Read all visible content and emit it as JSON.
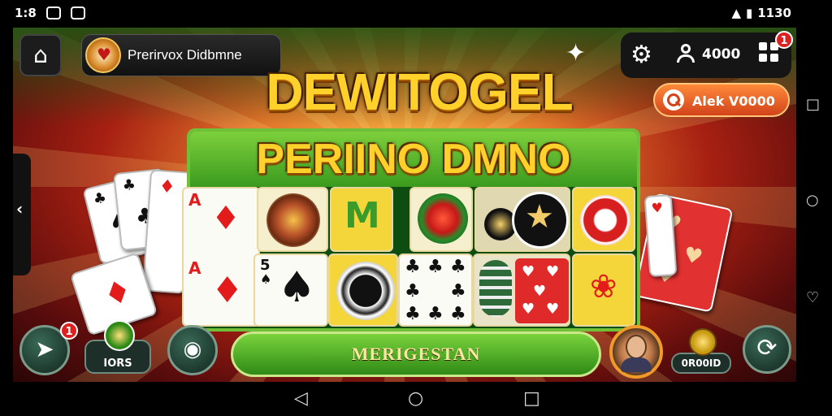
{
  "status_bar": {
    "time_left": "1:8",
    "time_right": "1130",
    "signal": "◂"
  },
  "profile": {
    "name": "Prerirvox Didbmne"
  },
  "top_bar": {
    "coins": "4000",
    "notification_count": "1"
  },
  "search": {
    "label": "Alek V0000"
  },
  "titles": {
    "main": "DEWITOGEL",
    "sub": "PERIINO DMNO"
  },
  "bottom": {
    "left_badge": "1",
    "pill_left_label": "IORS",
    "main_button": "MERIGESTAN",
    "pill_right_label": "0R00ID"
  },
  "icons": {
    "home": "home-icon",
    "gear": "gear-icon",
    "user": "user-icon",
    "grid": "grid-icon",
    "puzzle": "puzzle-icon",
    "search": "search-icon",
    "refresh": "refresh-icon",
    "lock": "lock-icon",
    "back": "back-icon"
  },
  "colors": {
    "accent_gold": "#ffd12a",
    "accent_green": "#3b9a1e",
    "accent_orange": "#d2431a",
    "badge_red": "#e01f1f"
  }
}
